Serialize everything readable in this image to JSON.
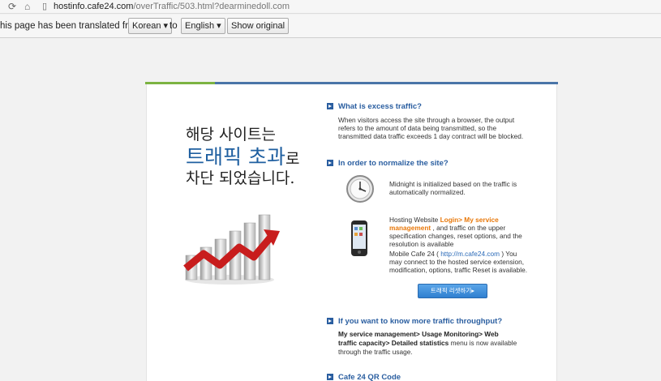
{
  "browser": {
    "url_host": "hostinfo.cafe24.com",
    "url_path": "/overTraffic/503.html?dearminedoll.com"
  },
  "translate_bar": {
    "prefix": "his page has been translated from",
    "from_lang": "Korean",
    "to_text": "to",
    "to_lang": "English",
    "show_original": "Show original"
  },
  "banner": {
    "line1": "해당 사이트는",
    "line2_main": "트래픽 초과",
    "line2_suffix": "로",
    "line3": "차단 되었습니다."
  },
  "sections": {
    "excess": {
      "heading": "What is excess traffic?",
      "lines": [
        "When visitors access the site through a browser, the output",
        "refers to the amount of data being transmitted, so the",
        "transmitted data traffic exceeds 1 day contract will be blocked."
      ]
    },
    "normalize": {
      "heading": "In order to normalize the site?",
      "midnight_lines": [
        "Midnight is initialized based on the traffic is",
        "automatically normalized."
      ],
      "hosting_pre": "Hosting Website",
      "hosting_login": "Login> My service",
      "hosting_mgmt": "management",
      "hosting_post": ", and traffic on the upper",
      "hosting_lines": [
        "specification changes, reset options, and the",
        "resolution is available"
      ],
      "mobile_pre": "Mobile Cafe 24 (",
      "mobile_link": "http://m.cafe24.com",
      "mobile_post": ") You",
      "mobile_lines": [
        "may connect to the hosted service extension,",
        "modification, options, traffic Reset is available."
      ],
      "reset_button": "트래픽 리셋하기▸"
    },
    "throughput": {
      "heading": "If you want to know more traffic throughput?",
      "bold_lines": [
        "My service management> Usage Monitoring> Web",
        "traffic capacity> Detailed statistics"
      ],
      "suffix": "menu is now available",
      "lines": [
        "through the traffic usage."
      ]
    },
    "qr": {
      "heading": "Cafe 24 QR Code"
    }
  },
  "colors": {
    "accent_green": "#7cb342",
    "accent_blue": "#4a75a8",
    "heading_blue": "#2a5ea0",
    "orange": "#e8780a"
  },
  "chart_data": {
    "type": "bar",
    "categories": [
      "",
      "",
      "",
      "",
      "",
      ""
    ],
    "values": [
      3,
      4,
      5,
      6,
      7,
      8
    ]
  }
}
